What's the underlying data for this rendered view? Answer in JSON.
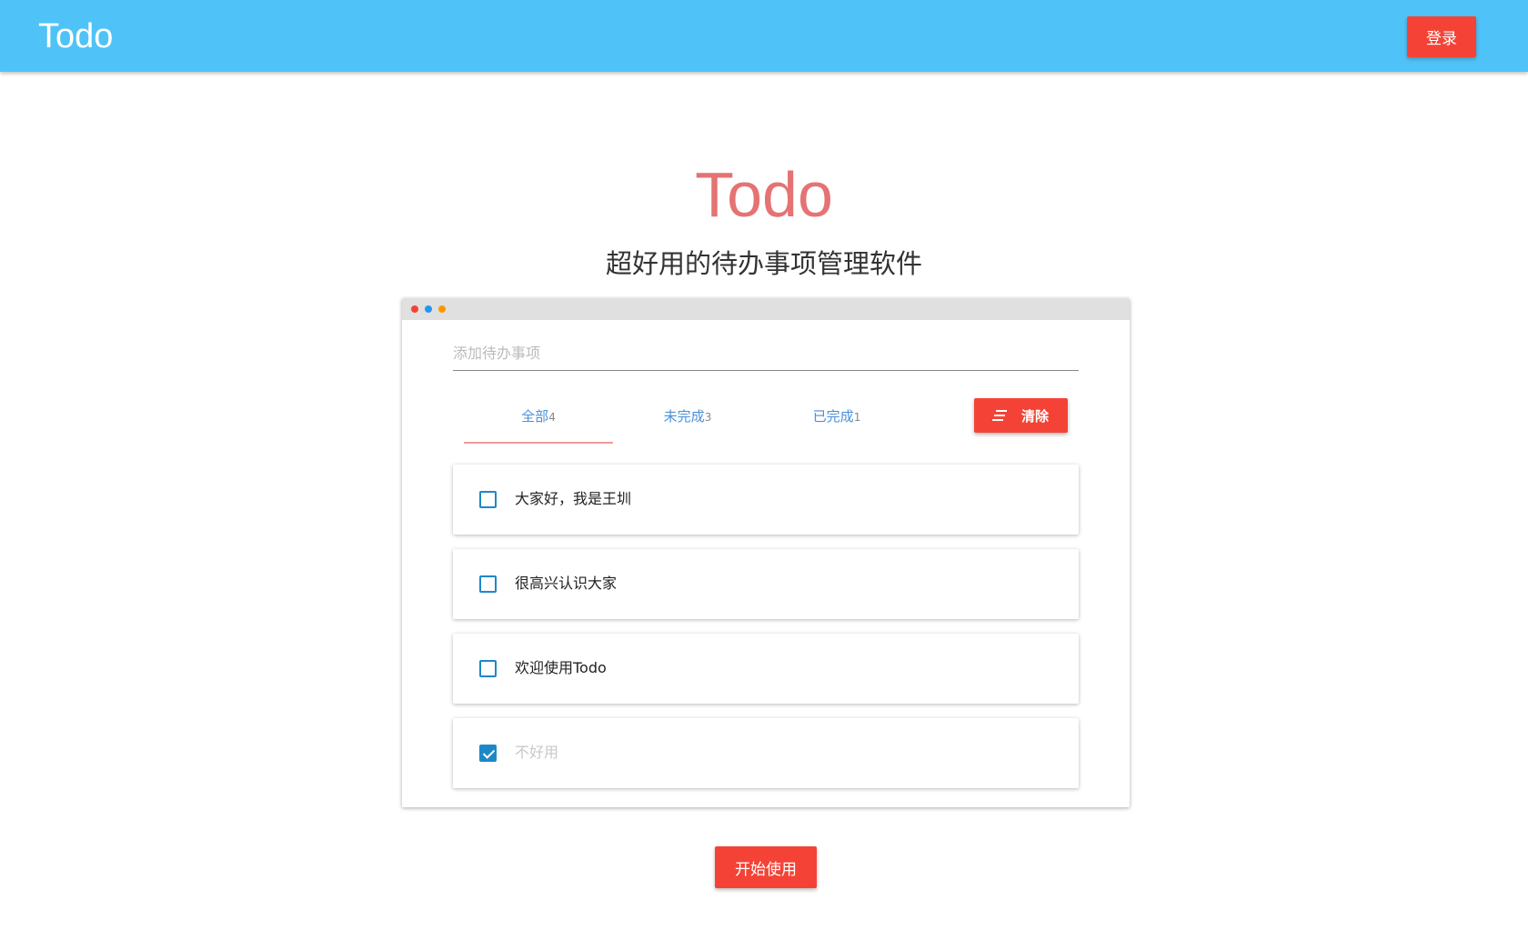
{
  "header": {
    "brand": "Todo",
    "login_label": "登录",
    "background_color": "#4fc3f7"
  },
  "hero": {
    "title": "Todo",
    "subtitle": "超好用的待办事项管理软件",
    "title_color": "#e57373"
  },
  "window": {
    "dot_colors": [
      "#f44336",
      "#2196f3",
      "#ff9800"
    ],
    "add_input": {
      "placeholder": "添加待办事项",
      "value": ""
    },
    "tabs": [
      {
        "label": "全部",
        "count": "4",
        "active": true
      },
      {
        "label": "未完成",
        "count": "3",
        "active": false
      },
      {
        "label": "已完成",
        "count": "1",
        "active": false
      }
    ],
    "clear_label": "清除",
    "todos": [
      {
        "text": "大家好，我是王圳",
        "done": false
      },
      {
        "text": "很高兴认识大家",
        "done": false
      },
      {
        "text": "欢迎使用Todo",
        "done": false
      },
      {
        "text": "不好用",
        "done": true
      }
    ]
  },
  "start_label": "开始使用",
  "accent_color": "#f44336"
}
